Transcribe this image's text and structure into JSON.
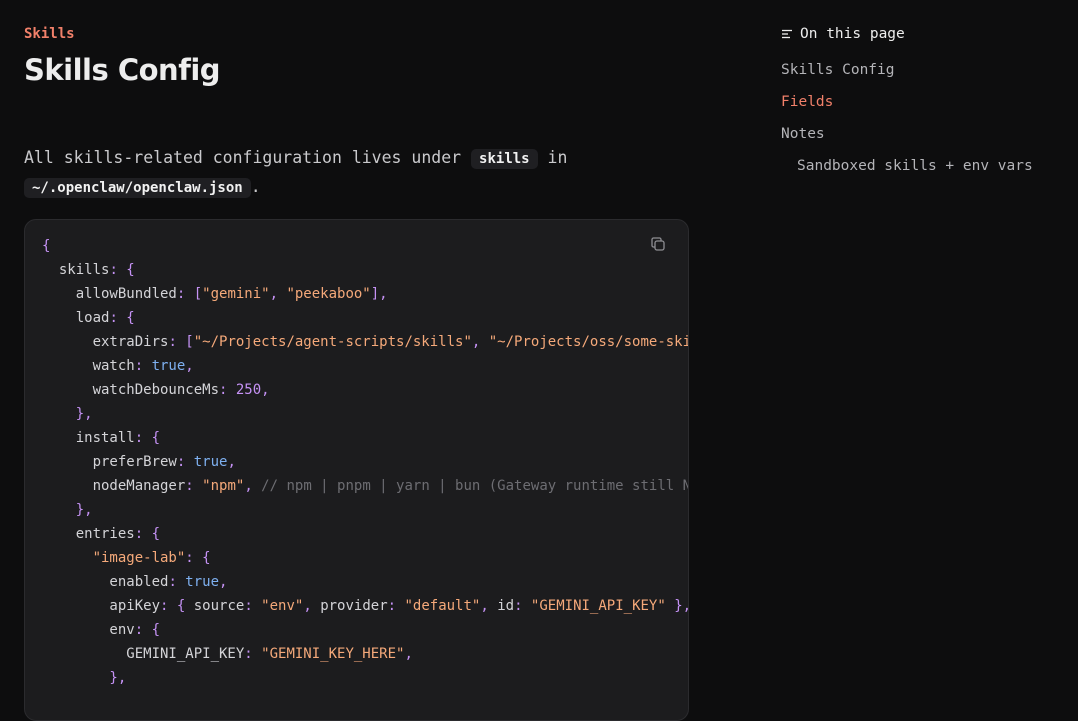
{
  "breadcrumb": "Skills",
  "title": "Skills Config",
  "intro": {
    "text_before": "All skills-related configuration lives under",
    "code1": "skills",
    "text_middle": "in",
    "code2": "~/.openclaw/openclaw.json",
    "text_after": "."
  },
  "code": {
    "lines": [
      [
        [
          "p",
          "{"
        ]
      ],
      [
        [
          "k",
          "  skills"
        ],
        [
          "p",
          ": {"
        ]
      ],
      [
        [
          "k",
          "    allowBundled"
        ],
        [
          "p",
          ": ["
        ],
        [
          "s",
          "\"gemini\""
        ],
        [
          "p",
          ", "
        ],
        [
          "s",
          "\"peekaboo\""
        ],
        [
          "p",
          "],"
        ]
      ],
      [
        [
          "k",
          "    load"
        ],
        [
          "p",
          ": {"
        ]
      ],
      [
        [
          "k",
          "      extraDirs"
        ],
        [
          "p",
          ": ["
        ],
        [
          "s",
          "\"~/Projects/agent-scripts/skills\""
        ],
        [
          "p",
          ", "
        ],
        [
          "s",
          "\"~/Projects/oss/some-ski"
        ]
      ],
      [
        [
          "k",
          "      watch"
        ],
        [
          "p",
          ": "
        ],
        [
          "b",
          "true"
        ],
        [
          "p",
          ","
        ]
      ],
      [
        [
          "k",
          "      watchDebounceMs"
        ],
        [
          "p",
          ": "
        ],
        [
          "n",
          "250"
        ],
        [
          "p",
          ","
        ]
      ],
      [
        [
          "p",
          "    },"
        ]
      ],
      [
        [
          "k",
          "    install"
        ],
        [
          "p",
          ": {"
        ]
      ],
      [
        [
          "k",
          "      preferBrew"
        ],
        [
          "p",
          ": "
        ],
        [
          "b",
          "true"
        ],
        [
          "p",
          ","
        ]
      ],
      [
        [
          "k",
          "      nodeManager"
        ],
        [
          "p",
          ": "
        ],
        [
          "s",
          "\"npm\""
        ],
        [
          "p",
          ", "
        ],
        [
          "c",
          "// npm | pnpm | yarn | bun (Gateway runtime still N"
        ]
      ],
      [
        [
          "p",
          "    },"
        ]
      ],
      [
        [
          "k",
          "    entries"
        ],
        [
          "p",
          ": {"
        ]
      ],
      [
        [
          "s",
          "      \"image-lab\""
        ],
        [
          "p",
          ": {"
        ]
      ],
      [
        [
          "k",
          "        enabled"
        ],
        [
          "p",
          ": "
        ],
        [
          "b",
          "true"
        ],
        [
          "p",
          ","
        ]
      ],
      [
        [
          "k",
          "        apiKey"
        ],
        [
          "p",
          ": { "
        ],
        [
          "k",
          "source"
        ],
        [
          "p",
          ": "
        ],
        [
          "s",
          "\"env\""
        ],
        [
          "p",
          ", "
        ],
        [
          "k",
          "provider"
        ],
        [
          "p",
          ": "
        ],
        [
          "s",
          "\"default\""
        ],
        [
          "p",
          ", "
        ],
        [
          "k",
          "id"
        ],
        [
          "p",
          ": "
        ],
        [
          "s",
          "\"GEMINI_API_KEY\""
        ],
        [
          "p",
          " },"
        ]
      ],
      [
        [
          "k",
          "        env"
        ],
        [
          "p",
          ": {"
        ]
      ],
      [
        [
          "k",
          "          GEMINI_API_KEY"
        ],
        [
          "p",
          ": "
        ],
        [
          "s",
          "\"GEMINI_KEY_HERE\""
        ],
        [
          "p",
          ","
        ]
      ],
      [
        [
          "p",
          "        },"
        ]
      ]
    ]
  },
  "toc": {
    "heading": "On this page",
    "items": [
      {
        "label": "Skills Config",
        "active": false,
        "sub": false
      },
      {
        "label": "Fields",
        "active": true,
        "sub": false
      },
      {
        "label": "Notes",
        "active": false,
        "sub": false
      },
      {
        "label": "Sandboxed skills + env vars",
        "active": false,
        "sub": true
      }
    ]
  },
  "icons": {
    "toc": "list-lines-icon",
    "copy": "copy-icon"
  },
  "colors": {
    "accent": "#f1806a",
    "background": "#0d0d0e",
    "code_bg": "#1c1c1e"
  }
}
